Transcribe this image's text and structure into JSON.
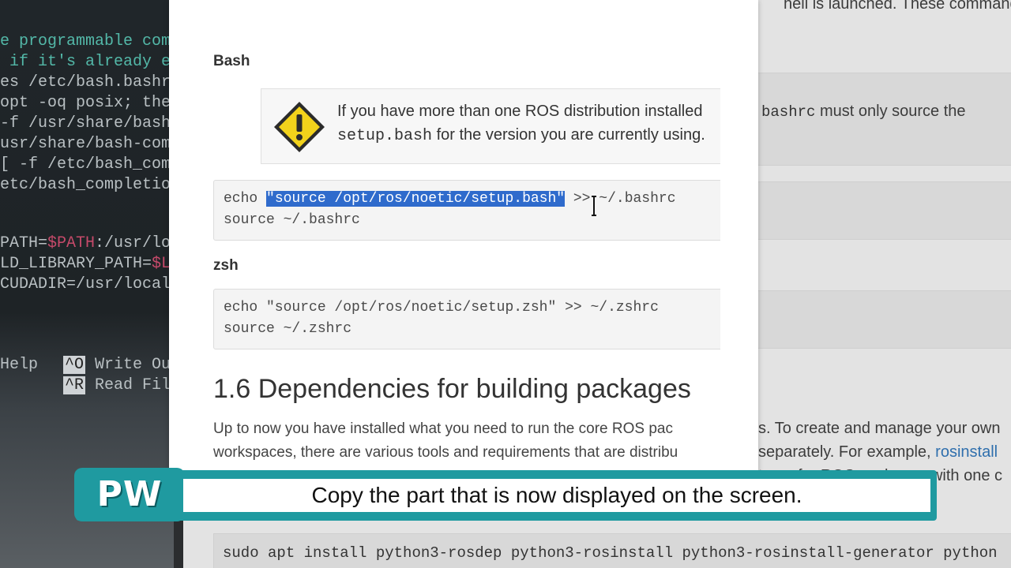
{
  "terminal": {
    "lines": [
      "e programmable com",
      " if it's already e",
      "es /etc/bash.bashr",
      "opt -oq posix; the",
      "-f /usr/share/bash",
      "usr/share/bash-com",
      "[ -f /etc/bash_com",
      "etc/bash_completio"
    ],
    "env_lines": [
      {
        "pre": "PATH=",
        "var": "$PATH",
        "post": ":/usr/lo"
      },
      {
        "pre": "LD_LIBRARY_PATH=",
        "var": "$L",
        "post": ""
      },
      {
        "pre": "CUDADIR=/usr/local",
        "var": "",
        "post": ""
      }
    ],
    "nano_help": {
      "help_label": "Help",
      "write_key": "^O",
      "write_label": "Write Out",
      "read_key": "^R",
      "read_label": "Read File"
    }
  },
  "background_page": {
    "top_text": "hell is launched. These commands",
    "bashrc_text_mono": "bashrc",
    "bashrc_text": " must only source the",
    "para_line1": "s. To create and manage your own",
    "para_line2_pre": "separately. For example, ",
    "para_line2_link": "rosinstall",
    "para_line3": "trees for ROS packages with one c",
    "install_cmd": "sudo apt install python3-rosdep python3-rosinstall python3-rosinstall-generator python"
  },
  "doc": {
    "bash_heading": "Bash",
    "note": {
      "line1": "If you have more than one ROS distribution installed",
      "line2_mono": "setup.bash",
      "line2_rest": " for the version you are currently using."
    },
    "bash_code": {
      "line1_pre": "echo ",
      "line1_selected": "\"source /opt/ros/noetic/setup.bash\"",
      "line1_post": " >> ~/.bashrc",
      "line2": "source ~/.bashrc"
    },
    "zsh_heading": "zsh",
    "zsh_code": {
      "line1": "echo \"source /opt/ros/noetic/setup.zsh\" >> ~/.zshrc",
      "line2": "source ~/.zshrc"
    },
    "section_heading": "1.6 Dependencies for building packages",
    "para_line1": "Up to now you have installed what you need to run the core ROS pac",
    "para_line2": "workspaces, there are various tools and requirements that are distribu"
  },
  "caption": {
    "logo": "PW",
    "text": "Copy the part that is now displayed on the screen."
  },
  "colors": {
    "selection": "#2f6bcc",
    "caption_teal": "#1f9aa0",
    "link": "#2f6fad",
    "warning_yellow": "#f2d21b"
  }
}
